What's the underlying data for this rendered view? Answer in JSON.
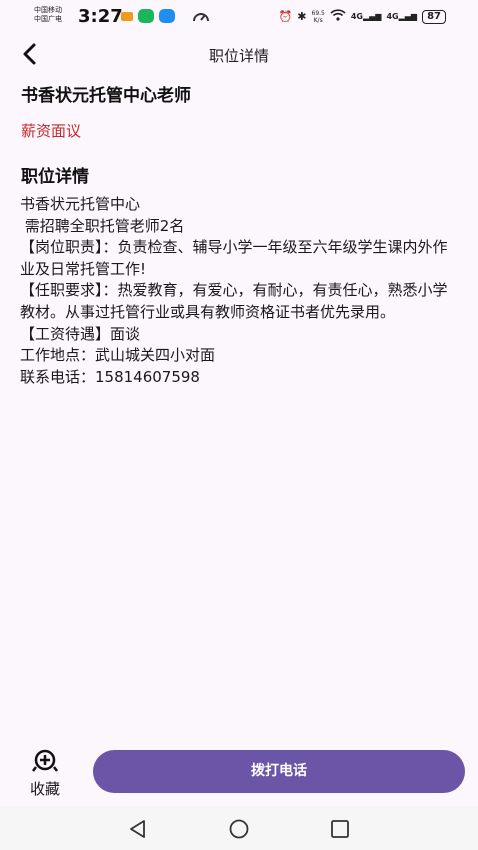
{
  "status_bar": {
    "carrier_line1": "中国移动",
    "carrier_line2": "中国广电",
    "time": "3:27",
    "net_speed_value": "69.5",
    "net_speed_unit": "K/s",
    "signal_1": "4G",
    "signal_2": "4G",
    "battery": "87"
  },
  "header": {
    "title": "职位详情"
  },
  "job": {
    "title": "书香状元托管中心老师",
    "salary": "薪资面议",
    "section_heading": "职位详情",
    "description": "书香状元托管中心\n 需招聘全职托管老师2名\n【岗位职责】：负责检查、辅导小学一年级至六年级学生课内外作业及日常托管工作!\n【任职要求】：热爱教育，有爱心，有耐心，有责任心，熟悉小学教材。从事过托管行业或具有教师资格证书者优先录用。\n【工资待遇】面谈\n工作地点：武山城关四小对面\n联系电话：15814607598"
  },
  "actions": {
    "favorite_label": "收藏",
    "call_label": "拨打电话"
  },
  "colors": {
    "accent": "#6a55a6",
    "salary": "#c42b2b",
    "background": "#fcf6fd"
  }
}
